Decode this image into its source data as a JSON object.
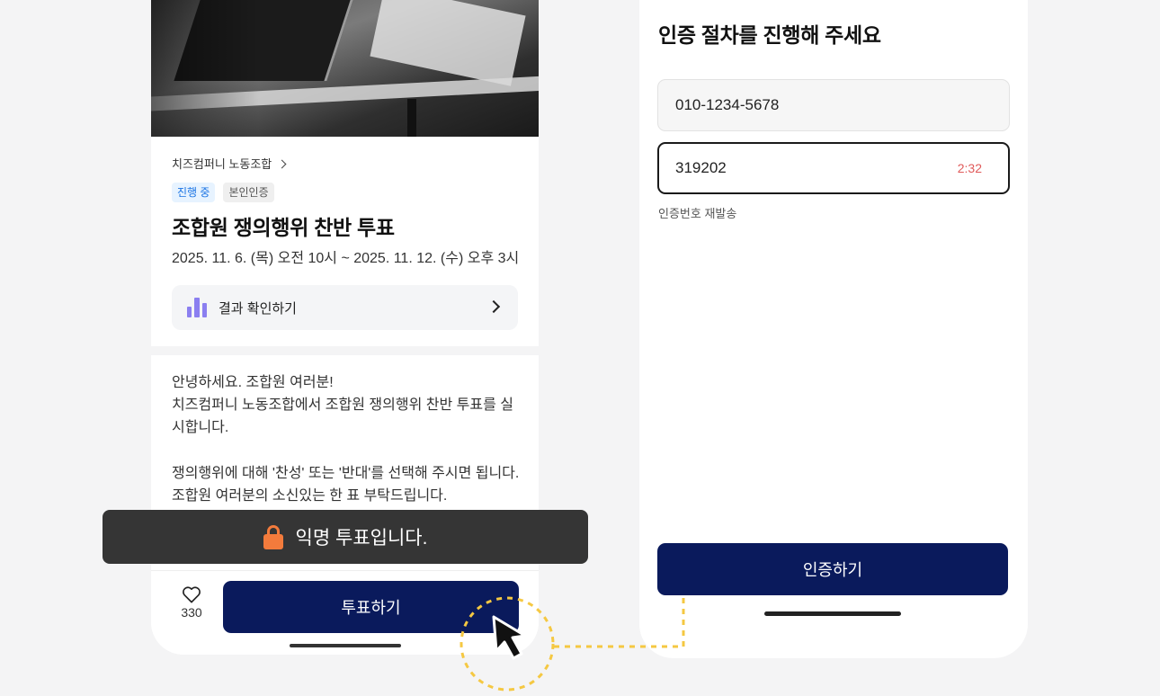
{
  "left_screen": {
    "org_name": "치즈컴퍼니 노동조합",
    "badges": {
      "status": "진행 중",
      "auth": "본인인증"
    },
    "vote_title": "조합원 쟁의행위 찬반 투표",
    "period": "2025. 11. 6. (목) 오전 10시 ~ 2025. 11. 12. (수) 오후 3시",
    "result_button": "결과 확인하기",
    "body": {
      "line1": "안녕하세요. 조합원 여러분!",
      "line2": "치즈컴퍼니 노동조합에서 조합원 쟁의행위 찬반 투표를 실시합니다.",
      "line3": "쟁의행위에 대해 '찬성' 또는 '반대'를 선택해 주시면 됩니다.",
      "line4": "조합원 여러분의 소신있는 한 표 부탁드립니다."
    },
    "like_count": "330",
    "vote_button": "투표하기"
  },
  "toast": {
    "text": "익명 투표입니다.",
    "icon": "lock-icon",
    "icon_color": "#f37b3c"
  },
  "right_screen": {
    "title": "인증 절차를 진행해 주세요",
    "phone_value": "010-1234-5678",
    "code_value": "319202",
    "timer": "2:32",
    "resend_label": "인증번호 재발송",
    "auth_button": "인증하기"
  },
  "colors": {
    "primary": "#0a1a5c",
    "accent_badge": "#1b74e4",
    "timer": "#e05a5a",
    "connector": "#f5c842"
  }
}
